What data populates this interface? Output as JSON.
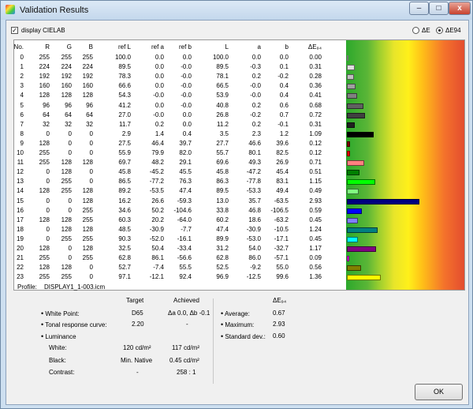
{
  "window": {
    "title": "Validation Results"
  },
  "options": {
    "display_cielab_label": "display CIELAB",
    "radio_de_label": "ΔE",
    "radio_de94_label": "ΔE94",
    "display_cielab_checked": true,
    "selected_radio": "ΔE94"
  },
  "table": {
    "headers": [
      "No.",
      "R",
      "G",
      "B",
      "ref L",
      "ref a",
      "ref b",
      "L",
      "a",
      "b",
      "ΔE₉₄"
    ],
    "rows": [
      [
        "0",
        "255",
        "255",
        "255",
        "100.0",
        "0.0",
        "0.0",
        "100.0",
        "0.0",
        "0.0",
        "0.00"
      ],
      [
        "1",
        "224",
        "224",
        "224",
        "89.5",
        "0.0",
        "-0.0",
        "89.5",
        "-0.3",
        "0.1",
        "0.31"
      ],
      [
        "2",
        "192",
        "192",
        "192",
        "78.3",
        "0.0",
        "-0.0",
        "78.1",
        "0.2",
        "-0.2",
        "0.28"
      ],
      [
        "3",
        "160",
        "160",
        "160",
        "66.6",
        "0.0",
        "-0.0",
        "66.5",
        "-0.0",
        "0.4",
        "0.36"
      ],
      [
        "4",
        "128",
        "128",
        "128",
        "54.3",
        "-0.0",
        "-0.0",
        "53.9",
        "-0.0",
        "0.4",
        "0.41"
      ],
      [
        "5",
        "96",
        "96",
        "96",
        "41.2",
        "0.0",
        "-0.0",
        "40.8",
        "0.2",
        "0.6",
        "0.68"
      ],
      [
        "6",
        "64",
        "64",
        "64",
        "27.0",
        "-0.0",
        "0.0",
        "26.8",
        "-0.2",
        "0.7",
        "0.72"
      ],
      [
        "7",
        "32",
        "32",
        "32",
        "11.7",
        "0.2",
        "0.0",
        "11.2",
        "0.2",
        "-0.1",
        "0.31"
      ],
      [
        "8",
        "0",
        "0",
        "0",
        "2.9",
        "1.4",
        "0.4",
        "3.5",
        "2.3",
        "1.2",
        "1.09"
      ],
      [
        "9",
        "128",
        "0",
        "0",
        "27.5",
        "46.4",
        "39.7",
        "27.7",
        "46.6",
        "39.6",
        "0.12"
      ],
      [
        "10",
        "255",
        "0",
        "0",
        "55.9",
        "79.9",
        "82.0",
        "55.7",
        "80.1",
        "82.5",
        "0.12"
      ],
      [
        "11",
        "255",
        "128",
        "128",
        "69.7",
        "48.2",
        "29.1",
        "69.6",
        "49.3",
        "26.9",
        "0.71"
      ],
      [
        "12",
        "0",
        "128",
        "0",
        "45.8",
        "-45.2",
        "45.5",
        "45.8",
        "-47.2",
        "45.4",
        "0.51"
      ],
      [
        "13",
        "0",
        "255",
        "0",
        "86.5",
        "-77.2",
        "76.3",
        "86.3",
        "-77.8",
        "83.1",
        "1.15"
      ],
      [
        "14",
        "128",
        "255",
        "128",
        "89.2",
        "-53.5",
        "47.4",
        "89.5",
        "-53.3",
        "49.4",
        "0.49"
      ],
      [
        "15",
        "0",
        "0",
        "128",
        "16.2",
        "26.6",
        "-59.3",
        "13.0",
        "35.7",
        "-63.5",
        "2.93"
      ],
      [
        "16",
        "0",
        "0",
        "255",
        "34.6",
        "50.2",
        "-104.6",
        "33.8",
        "46.8",
        "-106.5",
        "0.59"
      ],
      [
        "17",
        "128",
        "128",
        "255",
        "60.3",
        "20.2",
        "-64.0",
        "60.2",
        "18.6",
        "-63.2",
        "0.45"
      ],
      [
        "18",
        "0",
        "128",
        "128",
        "48.5",
        "-30.9",
        "-7.7",
        "47.4",
        "-30.9",
        "-10.5",
        "1.24"
      ],
      [
        "19",
        "0",
        "255",
        "255",
        "90.3",
        "-52.0",
        "-16.1",
        "89.9",
        "-53.0",
        "-17.1",
        "0.45"
      ],
      [
        "20",
        "128",
        "0",
        "128",
        "32.5",
        "50.4",
        "-33.4",
        "31.2",
        "54.0",
        "-32.7",
        "1.17"
      ],
      [
        "21",
        "255",
        "0",
        "255",
        "62.8",
        "86.1",
        "-56.6",
        "62.8",
        "86.0",
        "-57.1",
        "0.09"
      ],
      [
        "22",
        "128",
        "128",
        "0",
        "52.7",
        "-7.4",
        "55.5",
        "52.5",
        "-9.2",
        "55.0",
        "0.56"
      ],
      [
        "23",
        "255",
        "255",
        "0",
        "97.1",
        "-12.1",
        "92.4",
        "96.9",
        "-12.5",
        "99.6",
        "1.36"
      ]
    ],
    "bar_colors": [
      "#ffffff",
      "#e0e0e0",
      "#c0c0c0",
      "#a0a0a0",
      "#808080",
      "#606060",
      "#404040",
      "#202020",
      "#000000",
      "#800000",
      "#ff0000",
      "#ff8080",
      "#008000",
      "#00ff00",
      "#80ff80",
      "#000080",
      "#0000ff",
      "#8080ff",
      "#008080",
      "#00ffff",
      "#800080",
      "#ff00ff",
      "#808000",
      "#ffff00"
    ]
  },
  "info": {
    "profile_label": "Profile:",
    "profile_name": "DISPLAY1_1-003.icm",
    "col_target": "Target",
    "col_achieved": "Achieved",
    "white_point_label": "White Point:",
    "white_point_target": "D65",
    "white_point_achieved": "Δa 0.0, Δb -0.1",
    "trc_label": "Tonal response curve:",
    "trc_target": "2.20",
    "trc_achieved": "-",
    "luminance_label": "Luminance",
    "white_label": "White:",
    "white_target": "120 cd/m²",
    "white_achieved": "117 cd/m²",
    "black_label": "Black:",
    "black_target": "Min. Native",
    "black_achieved": "0.45 cd/m²",
    "contrast_label": "Contrast:",
    "contrast_target": "-",
    "contrast_achieved": "258 : 1",
    "stats_header": "ΔE₉₄",
    "average_label": "Average:",
    "average_value": "0.67",
    "maximum_label": "Maximum:",
    "maximum_value": "2.93",
    "stddev_label": "Standard dev.:",
    "stddev_value": "0.60"
  },
  "buttons": {
    "ok_label": "OK",
    "minimize": "–",
    "maximize": "□",
    "close": "x"
  }
}
